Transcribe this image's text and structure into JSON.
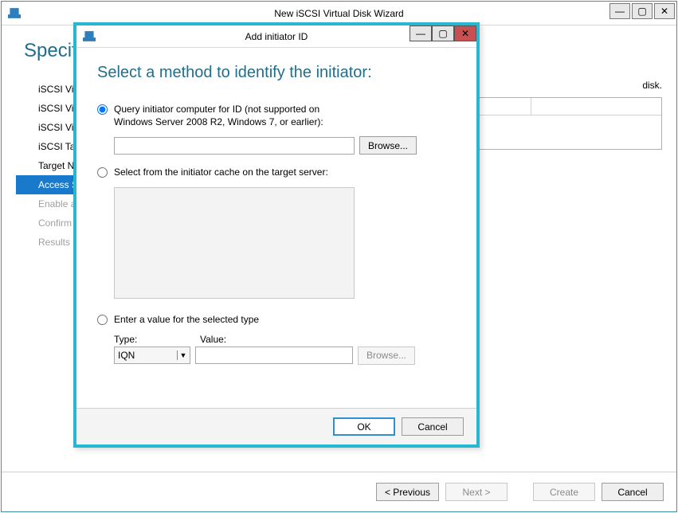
{
  "wizard": {
    "title": "New iSCSI Virtual Disk Wizard",
    "heading_fragment": "Specify",
    "instruction_fragment": "disk.",
    "steps": [
      {
        "label": "iSCSI Vi",
        "state": "normal"
      },
      {
        "label": "iSCSI Vi",
        "state": "normal"
      },
      {
        "label": "iSCSI Vi",
        "state": "normal"
      },
      {
        "label": "iSCSI Ta",
        "state": "normal"
      },
      {
        "label": "Target N",
        "state": "normal"
      },
      {
        "label": "Access S",
        "state": "active"
      },
      {
        "label": "Enable a",
        "state": "disabled"
      },
      {
        "label": "Confirm",
        "state": "disabled"
      },
      {
        "label": "Results",
        "state": "disabled"
      }
    ],
    "footer": {
      "previous": "< Previous",
      "next": "Next >",
      "create": "Create",
      "cancel": "Cancel"
    }
  },
  "dialog": {
    "title": "Add initiator ID",
    "heading": "Select a method to identify the initiator:",
    "option_query": "Query initiator computer for ID (not supported on Windows Server 2008 R2, Windows 7, or earlier):",
    "option_cache": "Select from the initiator cache on the target server:",
    "option_manual": "Enter a value for the selected type",
    "browse_label": "Browse...",
    "type_label": "Type:",
    "value_label": "Value:",
    "type_selected": "IQN",
    "ok": "OK",
    "cancel": "Cancel",
    "selected_option": "query"
  }
}
